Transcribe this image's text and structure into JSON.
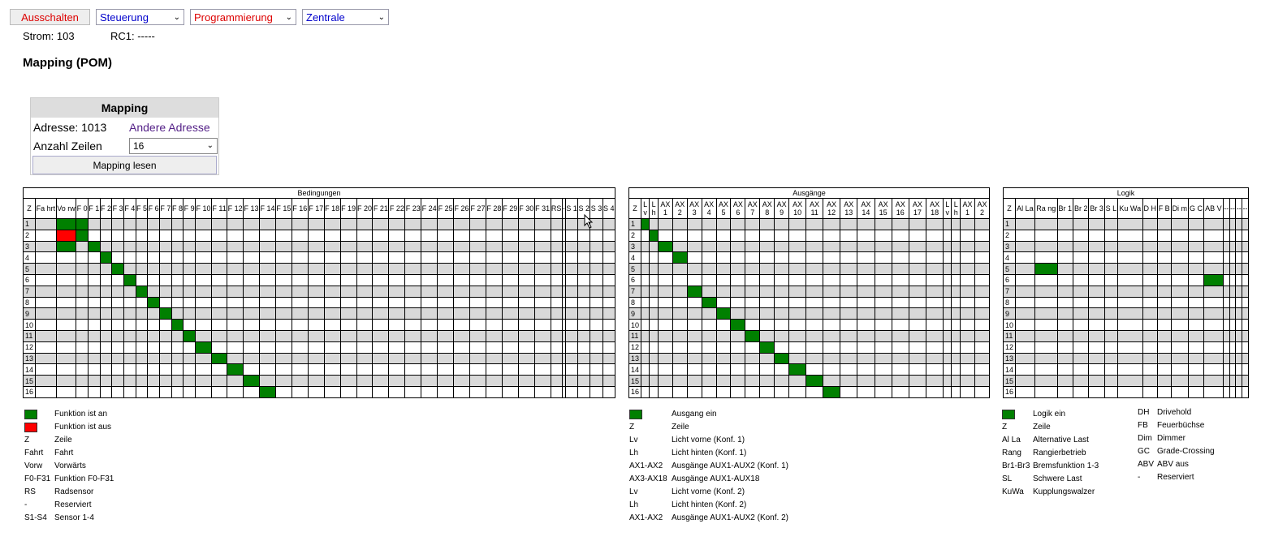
{
  "toolbar": {
    "power_button": "Ausschalten",
    "menus": [
      {
        "label": "Steuerung"
      },
      {
        "label": "Programmierung"
      },
      {
        "label": "Zentrale"
      }
    ],
    "colors": {
      "power": "#dd0000",
      "menu1": "#0000cc",
      "menu2": "#dd0000",
      "menu3": "#0000cc"
    }
  },
  "status": {
    "strom": "Strom: 103",
    "rc1": "RC1: -----"
  },
  "page_title": "Mapping (POM)",
  "mapping_panel": {
    "header": "Mapping",
    "address_label": "Adresse: 1013",
    "change_address_link": "Andere Adresse",
    "rows_label": "Anzahl Zeilen",
    "rows_value": "16",
    "read_button": "Mapping lesen"
  },
  "tables": [
    {
      "caption": "Bedingungen",
      "headers": [
        "Z",
        "Fa hrt",
        "Vo rw",
        "F 0",
        "F 1",
        "F 2",
        "F 3",
        "F 4",
        "F 5",
        "F 6",
        "F 7",
        "F 8",
        "F 9",
        "F 10",
        "F 11",
        "F 12",
        "F 13",
        "F 14",
        "F 15",
        "F 16",
        "F 17",
        "F 18",
        "F 19",
        "F 20",
        "F 21",
        "F 22",
        "F 23",
        "F 24",
        "F 25",
        "F 26",
        "F 27",
        "F 28",
        "F 29",
        "F 30",
        "F 31",
        "RS",
        "-",
        "S 1",
        "S 2",
        "S 3",
        "S 4"
      ],
      "rows": [
        "1",
        "2",
        "3",
        "4",
        "5",
        "6",
        "7",
        "8",
        "9",
        "10",
        "11",
        "12",
        "13",
        "14",
        "15",
        "16"
      ],
      "on_cells": [
        [
          0,
          2
        ],
        [
          0,
          3
        ],
        [
          1,
          3
        ],
        [
          2,
          2
        ],
        [
          2,
          4
        ],
        [
          3,
          5
        ],
        [
          4,
          6
        ],
        [
          5,
          7
        ],
        [
          6,
          8
        ],
        [
          7,
          9
        ],
        [
          8,
          10
        ],
        [
          9,
          11
        ],
        [
          10,
          12
        ],
        [
          11,
          13
        ],
        [
          12,
          14
        ],
        [
          13,
          15
        ],
        [
          14,
          16
        ],
        [
          15,
          17
        ]
      ],
      "off_cells": [
        [
          1,
          2
        ]
      ]
    },
    {
      "caption": "Ausgänge",
      "headers": [
        "Z",
        "L v",
        "L h",
        "AX 1",
        "AX 2",
        "AX 3",
        "AX 4",
        "AX 5",
        "AX 6",
        "AX 7",
        "AX 8",
        "AX 9",
        "AX 10",
        "AX 11",
        "AX 12",
        "AX 13",
        "AX 14",
        "AX 15",
        "AX 16",
        "AX 17",
        "AX 18",
        "L v",
        "L h",
        "AX 1",
        "AX 2"
      ],
      "rows": [
        "1",
        "2",
        "3",
        "4",
        "5",
        "6",
        "7",
        "8",
        "9",
        "10",
        "11",
        "12",
        "13",
        "14",
        "15",
        "16"
      ],
      "on_cells": [
        [
          0,
          1
        ],
        [
          1,
          2
        ],
        [
          2,
          3
        ],
        [
          3,
          4
        ],
        [
          6,
          5
        ],
        [
          7,
          6
        ],
        [
          8,
          7
        ],
        [
          9,
          8
        ],
        [
          10,
          9
        ],
        [
          11,
          10
        ],
        [
          12,
          11
        ],
        [
          13,
          12
        ],
        [
          14,
          13
        ],
        [
          15,
          14
        ]
      ],
      "off_cells": []
    },
    {
      "caption": "Logik",
      "headers": [
        "Z",
        "Al La",
        "Ra ng",
        "Br 1",
        "Br 2",
        "Br 3",
        "S L",
        "Ku Wa",
        "D H",
        "F B",
        "Di m",
        "G C",
        "AB V",
        "--",
        "--",
        "--",
        "--"
      ],
      "rows": [
        "1",
        "2",
        "3",
        "4",
        "5",
        "6",
        "7",
        "8",
        "9",
        "10",
        "11",
        "12",
        "13",
        "14",
        "15",
        "16"
      ],
      "on_cells": [
        [
          4,
          2
        ],
        [
          5,
          12
        ]
      ],
      "off_cells": []
    }
  ],
  "legends": {
    "bedingungen": [
      {
        "key": "",
        "text": "Funktion ist an",
        "swatch": "on"
      },
      {
        "key": "",
        "text": "Funktion ist aus",
        "swatch": "off"
      },
      {
        "key": "Z",
        "text": "Zeile"
      },
      {
        "key": "Fahrt",
        "text": "Fahrt"
      },
      {
        "key": "Vorw",
        "text": "Vorwärts"
      },
      {
        "key": "F0-F31",
        "text": "Funktion F0-F31"
      },
      {
        "key": "RS",
        "text": "Radsensor"
      },
      {
        "key": "-",
        "text": "Reserviert"
      },
      {
        "key": "S1-S4",
        "text": "Sensor 1-4"
      }
    ],
    "ausgaenge": [
      {
        "key": "",
        "text": "Ausgang ein",
        "swatch": "on"
      },
      {
        "key": "Z",
        "text": "Zeile"
      },
      {
        "key": "Lv",
        "text": "Licht vorne (Konf. 1)"
      },
      {
        "key": "Lh",
        "text": "Licht hinten (Konf. 1)"
      },
      {
        "key": "AX1-AX2",
        "text": "Ausgänge AUX1-AUX2 (Konf. 1)"
      },
      {
        "key": "AX3-AX18",
        "text": "Ausgänge AUX1-AUX18"
      },
      {
        "key": "Lv",
        "text": "Licht vorne (Konf. 2)"
      },
      {
        "key": "Lh",
        "text": "Licht hinten (Konf. 2)"
      },
      {
        "key": "AX1-AX2",
        "text": "Ausgänge AUX1-AUX2 (Konf. 2)"
      }
    ],
    "logik_left": [
      {
        "key": "",
        "text": "Logik ein",
        "swatch": "on"
      },
      {
        "key": "Z",
        "text": "Zeile"
      },
      {
        "key": "Al La",
        "text": "Alternative Last"
      },
      {
        "key": "Rang",
        "text": "Rangierbetrieb"
      },
      {
        "key": "Br1-Br3",
        "text": "Bremsfunktion 1-3"
      },
      {
        "key": "SL",
        "text": "Schwere Last"
      },
      {
        "key": "KuWa",
        "text": "Kupplungswalzer"
      }
    ],
    "logik_right": [
      {
        "key": "DH",
        "text": "Drivehold"
      },
      {
        "key": "FB",
        "text": "Feuerbüchse"
      },
      {
        "key": "Dim",
        "text": "Dimmer"
      },
      {
        "key": "GC",
        "text": "Grade-Crossing"
      },
      {
        "key": "ABV",
        "text": "ABV aus"
      },
      {
        "key": "-",
        "text": "Reserviert"
      }
    ]
  }
}
